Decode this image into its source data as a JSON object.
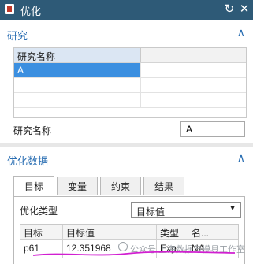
{
  "window": {
    "title": "优化",
    "refresh_icon": "refresh-icon",
    "close_icon": "close-icon",
    "title_bar_color": "#2e5a77"
  },
  "study": {
    "header": "研究",
    "table": {
      "column_header": "研究名称",
      "rows": [
        "A"
      ]
    },
    "name_label": "研究名称",
    "name_value": "A"
  },
  "optimization": {
    "header": "优化数据",
    "tabs": [
      "目标",
      "变量",
      "约束",
      "结果"
    ],
    "active_tab": "目标",
    "type_label": "优化类型",
    "type_value": "目标值",
    "grid": {
      "columns": [
        "目标",
        "目标值",
        "类型",
        "名..."
      ],
      "rows": [
        [
          "p61",
          "12.351968",
          "Exp...",
          "NA..."
        ]
      ]
    }
  },
  "watermark": "公众号 上海数据与模具工作室",
  "accent_color": "#2b6fb3",
  "selection_color": "#3b8fe0"
}
